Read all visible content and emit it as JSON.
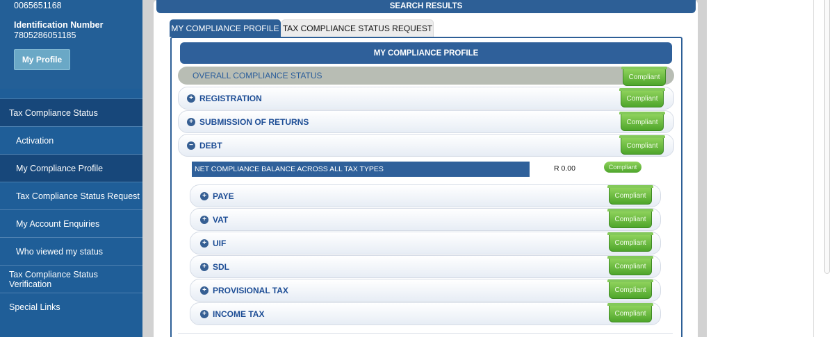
{
  "sidebar": {
    "reference_number": "0065651168",
    "id_label": "Identification Number",
    "id_value": "7805286051185",
    "profile_button": "My Profile",
    "nav": [
      {
        "label": "Tax Compliance Status"
      },
      {
        "label": "Activation"
      },
      {
        "label": "My Compliance Profile"
      },
      {
        "label": "Tax Compliance Status Request"
      },
      {
        "label": "My Account Enquiries"
      },
      {
        "label": "Who viewed my status"
      },
      {
        "label": "Tax Compliance Status Verification"
      },
      {
        "label": "Special Links"
      }
    ]
  },
  "main": {
    "results_title": "SEARCH RESULTS",
    "tabs": [
      {
        "label": "MY COMPLIANCE PROFILE",
        "active": true
      },
      {
        "label": "TAX COMPLIANCE STATUS REQUEST",
        "active": false
      }
    ],
    "profile_header": "MY COMPLIANCE PROFILE",
    "overall": {
      "label": "OVERALL COMPLIANCE STATUS",
      "status": "Compliant"
    },
    "sections": [
      {
        "label": "REGISTRATION",
        "expanded": false,
        "icon": "+",
        "status": "Compliant"
      },
      {
        "label": "SUBMISSION OF RETURNS",
        "expanded": false,
        "icon": "+",
        "status": "Compliant"
      },
      {
        "label": "DEBT",
        "expanded": true,
        "icon": "−",
        "status": "Compliant"
      }
    ],
    "net_balance": {
      "label": "NET COMPLIANCE BALANCE ACROSS ALL TAX TYPES",
      "value": "R  0.00",
      "status": "Compliant"
    },
    "tax_types": [
      {
        "label": "PAYE",
        "icon": "+",
        "status": "Compliant"
      },
      {
        "label": "VAT",
        "icon": "+",
        "status": "Compliant"
      },
      {
        "label": "UIF",
        "icon": "+",
        "status": "Compliant"
      },
      {
        "label": "SDL",
        "icon": "+",
        "status": "Compliant"
      },
      {
        "label": "PROVISIONAL TAX",
        "icon": "+",
        "status": "Compliant"
      },
      {
        "label": "INCOME TAX",
        "icon": "+",
        "status": "Compliant"
      }
    ]
  }
}
